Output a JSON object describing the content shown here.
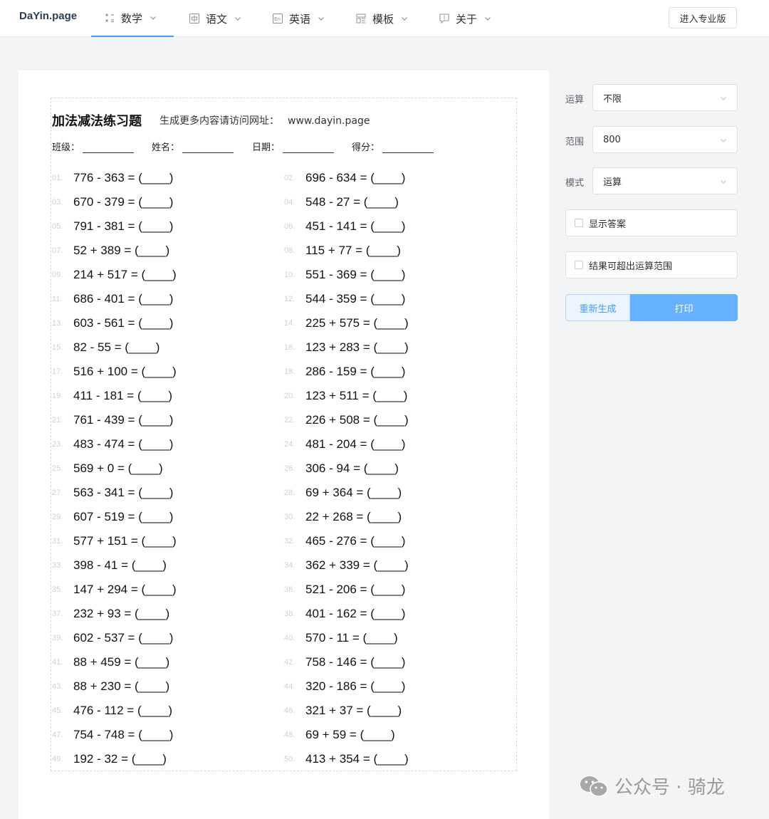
{
  "nav": {
    "brand": "DaYin.page",
    "items": [
      {
        "label": "数学"
      },
      {
        "label": "语文"
      },
      {
        "label": "英语"
      },
      {
        "label": "模板"
      },
      {
        "label": "关于"
      }
    ],
    "pro_label": "进入专业版"
  },
  "sheet": {
    "title": "加法减法练习题",
    "subtitle": "生成更多内容请访问网址：",
    "url": "www.dayin.page",
    "fields": [
      "班级：",
      "姓名：",
      "日期：",
      "得分："
    ],
    "problems": [
      {
        "n": "01.",
        "e": "776 - 363 = (____)"
      },
      {
        "n": "02.",
        "e": "696 - 634 = (____)"
      },
      {
        "n": "03.",
        "e": "670 - 379 = (____)"
      },
      {
        "n": "04.",
        "e": "548 - 27 = (____)"
      },
      {
        "n": "05.",
        "e": "791 - 381 = (____)"
      },
      {
        "n": "06.",
        "e": "451 - 141 = (____)"
      },
      {
        "n": "07.",
        "e": "52 + 389 = (____)"
      },
      {
        "n": "08.",
        "e": "115 + 77 = (____)"
      },
      {
        "n": "09.",
        "e": "214 + 517 = (____)"
      },
      {
        "n": "10.",
        "e": "551 - 369 = (____)"
      },
      {
        "n": "11.",
        "e": "686 - 401 = (____)"
      },
      {
        "n": "12.",
        "e": "544 - 359 = (____)"
      },
      {
        "n": "13.",
        "e": "603 - 561 = (____)"
      },
      {
        "n": "14.",
        "e": "225 + 575 = (____)"
      },
      {
        "n": "15.",
        "e": "82 - 55 = (____)"
      },
      {
        "n": "16.",
        "e": "123 + 283 = (____)"
      },
      {
        "n": "17.",
        "e": "516 + 100 = (____)"
      },
      {
        "n": "18.",
        "e": "286 - 159 = (____)"
      },
      {
        "n": "19.",
        "e": "411 - 181 = (____)"
      },
      {
        "n": "20.",
        "e": "123 + 511 = (____)"
      },
      {
        "n": "21.",
        "e": "761 - 439 = (____)"
      },
      {
        "n": "22.",
        "e": "226 + 508 = (____)"
      },
      {
        "n": "23.",
        "e": "483 - 474 = (____)"
      },
      {
        "n": "24.",
        "e": "481 - 204 = (____)"
      },
      {
        "n": "25.",
        "e": "569 + 0 = (____)"
      },
      {
        "n": "26.",
        "e": "306 - 94 = (____)"
      },
      {
        "n": "27.",
        "e": "563 - 341 = (____)"
      },
      {
        "n": "28.",
        "e": "69 + 364 = (____)"
      },
      {
        "n": "29.",
        "e": "607 - 519 = (____)"
      },
      {
        "n": "30.",
        "e": "22 + 268 = (____)"
      },
      {
        "n": "31.",
        "e": "577 + 151 = (____)"
      },
      {
        "n": "32.",
        "e": "465 - 276 = (____)"
      },
      {
        "n": "33.",
        "e": "398 - 41 = (____)"
      },
      {
        "n": "34.",
        "e": "362 + 339 = (____)"
      },
      {
        "n": "35.",
        "e": "147 + 294 = (____)"
      },
      {
        "n": "36.",
        "e": "521 - 206 = (____)"
      },
      {
        "n": "37.",
        "e": "232 + 93 = (____)"
      },
      {
        "n": "38.",
        "e": "401 - 162 = (____)"
      },
      {
        "n": "39.",
        "e": "602 - 537 = (____)"
      },
      {
        "n": "40.",
        "e": "570 - 11 = (____)"
      },
      {
        "n": "41.",
        "e": "88 + 459 = (____)"
      },
      {
        "n": "42.",
        "e": "758 - 146 = (____)"
      },
      {
        "n": "43.",
        "e": "88 + 230 = (____)"
      },
      {
        "n": "44.",
        "e": "320 - 186 = (____)"
      },
      {
        "n": "45.",
        "e": "476 - 112 = (____)"
      },
      {
        "n": "46.",
        "e": "321 + 37 = (____)"
      },
      {
        "n": "47.",
        "e": "754 - 748 = (____)"
      },
      {
        "n": "48.",
        "e": "69 + 59 = (____)"
      },
      {
        "n": "49.",
        "e": "192 - 32 = (____)"
      },
      {
        "n": "50.",
        "e": "413 + 354 = (____)"
      }
    ]
  },
  "panel": {
    "op_label": "运算",
    "op_value": "不限",
    "range_label": "范围",
    "range_value": "800",
    "mode_label": "模式",
    "mode_value": "运算",
    "show_answer": "显示答案",
    "exceed_range": "结果可超出运算范围",
    "regen": "重新生成",
    "print": "打印"
  },
  "watermark": {
    "text": "公众号 · 骑龙"
  },
  "colors": {
    "accent": "#409eff",
    "print_button": "#66b1ff"
  }
}
